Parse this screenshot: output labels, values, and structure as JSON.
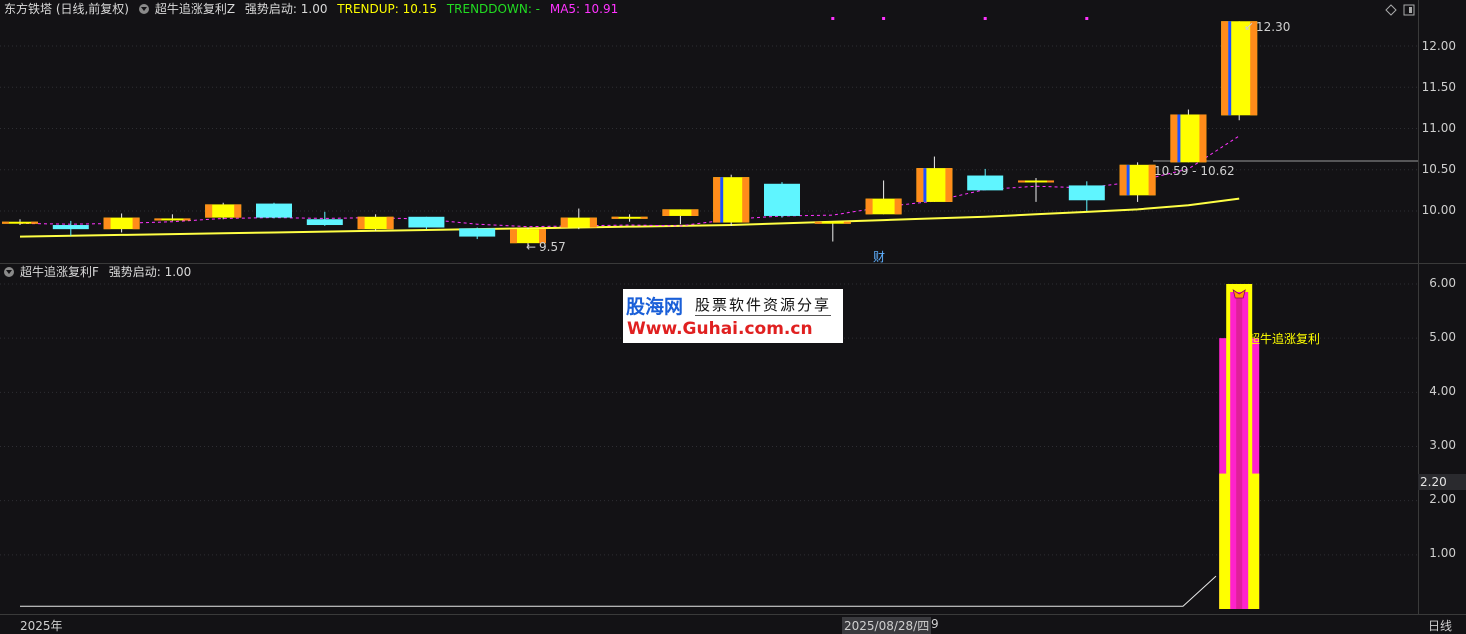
{
  "top_legend": {
    "stock": "东方铁塔 (日线,前复权)",
    "indicator": "超牛追涨复利Z",
    "qsqd": "强势启动: 1.00",
    "trendup": "TRENDUP: 10.15",
    "trenddown": "TRENDDOWN: -",
    "ma5": "MA5: 10.91"
  },
  "bottom_legend": {
    "indicator": "超牛追涨复利F",
    "qsqd": "强势启动: 1.00"
  },
  "top_axis": [
    "12.00",
    "11.50",
    "11.00",
    "10.50",
    "10.00"
  ],
  "bottom_axis": [
    "6.00",
    "5.00",
    "4.00",
    "3.00",
    "2.00",
    "1.00"
  ],
  "price_marker": "2.20",
  "annotations": {
    "high": "12.30",
    "low": "9.57",
    "range": "10.59 - 10.62",
    "cai": "财",
    "signal_text": "超牛追涨复利"
  },
  "watermark": {
    "brand": "股海网",
    "slogan": "股票软件资源分享",
    "url": "Www.Guhai.com.cn"
  },
  "bottom_bar": {
    "year": "2025年",
    "cursor_date": "2025/08/28/四",
    "cursor_extra": "9",
    "period": "日线"
  },
  "colors": {
    "up_body": "#ffff00",
    "up_stripe": "#ff8c1a",
    "up_stripe2": "#1e50ff",
    "down": "#5ff5ff",
    "trendup": "#ffff44",
    "ma5": "#ff33ff",
    "bar_yellow": "#ffff00",
    "bar_magenta": "#ff22cc"
  },
  "candles": [
    {
      "o": 9.87,
      "h": 9.9,
      "l": 9.83,
      "c": 9.87
    },
    {
      "o": 9.83,
      "h": 9.88,
      "l": 9.7,
      "c": 9.78
    },
    {
      "o": 9.78,
      "h": 9.97,
      "l": 9.74,
      "c": 9.92
    },
    {
      "o": 9.91,
      "h": 9.96,
      "l": 9.88,
      "c": 9.91
    },
    {
      "o": 9.92,
      "h": 10.1,
      "l": 9.9,
      "c": 10.08
    },
    {
      "o": 10.09,
      "h": 10.1,
      "l": 9.91,
      "c": 9.92
    },
    {
      "o": 9.9,
      "h": 9.99,
      "l": 9.82,
      "c": 9.83
    },
    {
      "o": 9.78,
      "h": 9.96,
      "l": 9.76,
      "c": 9.93
    },
    {
      "o": 9.93,
      "h": 9.93,
      "l": 9.78,
      "c": 9.8
    },
    {
      "o": 9.79,
      "h": 9.8,
      "l": 9.66,
      "c": 9.69
    },
    {
      "o": 9.61,
      "h": 9.8,
      "l": 9.57,
      "c": 9.78
    },
    {
      "o": 9.8,
      "h": 10.03,
      "l": 9.78,
      "c": 9.92
    },
    {
      "o": 9.93,
      "h": 9.96,
      "l": 9.87,
      "c": 9.93
    },
    {
      "o": 9.94,
      "h": 10.02,
      "l": 9.84,
      "c": 10.02
    },
    {
      "o": 9.86,
      "h": 10.44,
      "l": 9.82,
      "c": 10.41
    },
    {
      "o": 10.33,
      "h": 10.35,
      "l": 9.92,
      "c": 9.94
    },
    {
      "o": 9.87,
      "h": 9.87,
      "l": 9.63,
      "c": 9.87
    },
    {
      "o": 9.96,
      "h": 10.37,
      "l": 9.96,
      "c": 10.15
    },
    {
      "o": 10.11,
      "h": 10.66,
      "l": 10.11,
      "c": 10.52
    },
    {
      "o": 10.43,
      "h": 10.51,
      "l": 10.25,
      "c": 10.25
    },
    {
      "o": 10.37,
      "h": 10.4,
      "l": 10.11,
      "c": 10.37
    },
    {
      "o": 10.31,
      "h": 10.36,
      "l": 10.0,
      "c": 10.13
    },
    {
      "o": 10.19,
      "h": 10.59,
      "l": 10.11,
      "c": 10.56
    },
    {
      "o": 10.59,
      "h": 11.23,
      "l": 10.59,
      "c": 11.17
    },
    {
      "o": 11.16,
      "h": 12.3,
      "l": 11.1,
      "c": 12.3
    }
  ],
  "trendup": [
    9.69,
    9.7,
    9.71,
    9.72,
    9.73,
    9.74,
    9.75,
    9.76,
    9.77,
    9.78,
    9.79,
    9.8,
    9.81,
    9.82,
    9.83,
    9.85,
    9.87,
    9.89,
    9.91,
    9.93,
    9.96,
    9.99,
    10.02,
    10.07,
    10.15
  ],
  "ma5": [
    9.85,
    9.84,
    9.85,
    9.87,
    9.91,
    9.92,
    9.91,
    9.92,
    9.9,
    9.84,
    9.81,
    9.82,
    9.83,
    9.82,
    9.9,
    9.94,
    9.95,
    10.05,
    10.12,
    10.26,
    10.3,
    10.28,
    10.36,
    10.51,
    10.91
  ],
  "markers": [
    16,
    17,
    19,
    21
  ],
  "bottom_bar_data": {
    "outer_low": 2.5,
    "outer_high": 5.0,
    "yellow_max": 6.0,
    "line_start": 0.05,
    "line_end": 0.7
  }
}
